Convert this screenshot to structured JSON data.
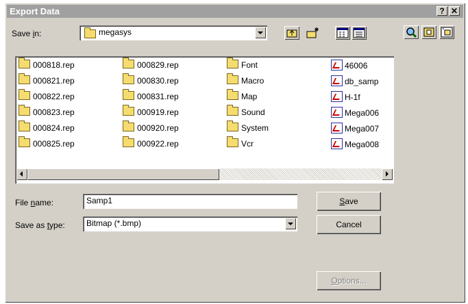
{
  "window": {
    "title": "Export Data"
  },
  "title_buttons": [
    {
      "name": "help-button",
      "label": "?"
    },
    {
      "name": "close-button",
      "label": "✕"
    }
  ],
  "save_in": {
    "label_prefix": "Save ",
    "label_mnemonic": "i",
    "label_suffix": "n:",
    "value": "megasys",
    "icon": "folder-icon"
  },
  "toolbar": [
    {
      "name": "up-one-level-button",
      "icon": "up-folder-icon"
    },
    {
      "name": "create-new-folder-button",
      "icon": "new-folder-icon"
    },
    {
      "name": "list-view-button",
      "icon": "list-view-icon"
    },
    {
      "name": "details-view-button",
      "icon": "details-view-icon"
    }
  ],
  "extra_toolbar": [
    {
      "name": "find-button",
      "icon": "magnifier-icon"
    },
    {
      "name": "preview-button",
      "icon": "preview-icon"
    },
    {
      "name": "properties-button",
      "icon": "properties-icon"
    }
  ],
  "files": [
    {
      "name": "000818.rep",
      "type": "folder"
    },
    {
      "name": "000821.rep",
      "type": "folder"
    },
    {
      "name": "000822.rep",
      "type": "folder"
    },
    {
      "name": "000823.rep",
      "type": "folder"
    },
    {
      "name": "000824.rep",
      "type": "folder"
    },
    {
      "name": "000825.rep",
      "type": "folder"
    },
    {
      "name": "000829.rep",
      "type": "folder"
    },
    {
      "name": "000830.rep",
      "type": "folder"
    },
    {
      "name": "000831.rep",
      "type": "folder"
    },
    {
      "name": "000919.rep",
      "type": "folder"
    },
    {
      "name": "000920.rep",
      "type": "folder"
    },
    {
      "name": "000922.rep",
      "type": "folder"
    },
    {
      "name": "Font",
      "type": "folder"
    },
    {
      "name": "Macro",
      "type": "folder"
    },
    {
      "name": "Map",
      "type": "folder"
    },
    {
      "name": "Sound",
      "type": "folder"
    },
    {
      "name": "System",
      "type": "folder"
    },
    {
      "name": "Vcr",
      "type": "folder"
    },
    {
      "name": "46006",
      "type": "report"
    },
    {
      "name": "db_samp",
      "type": "report"
    },
    {
      "name": "H-1f",
      "type": "report"
    },
    {
      "name": "Mega006",
      "type": "report"
    },
    {
      "name": "Mega007",
      "type": "report"
    },
    {
      "name": "Mega008",
      "type": "report"
    }
  ],
  "file_name": {
    "label_prefix": "File ",
    "label_mnemonic": "n",
    "label_suffix": "ame:",
    "value": "Samp1"
  },
  "save_as_type": {
    "label_prefix": "Save as ",
    "label_mnemonic": "t",
    "label_suffix": "ype:",
    "value": "Bitmap (*.bmp)"
  },
  "buttons": {
    "save": {
      "mnemonic": "S",
      "rest": "ave"
    },
    "cancel": "Cancel",
    "options": {
      "mnemonic": "O",
      "rest": "ptions..."
    }
  }
}
